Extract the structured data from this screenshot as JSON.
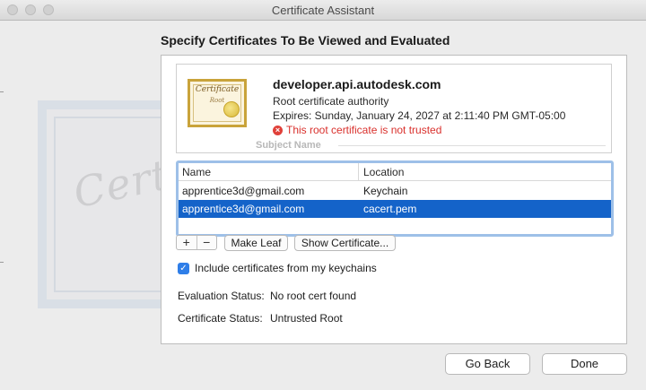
{
  "window": {
    "title": "Certificate Assistant"
  },
  "heading": "Specify Certificates To Be Viewed and Evaluated",
  "background_art": {
    "word": "Certificate"
  },
  "certificate": {
    "icon_title": "Certificate",
    "icon_sub": "Root",
    "name": "developer.api.autodesk.com",
    "kind": "Root certificate authority",
    "expires": "Expires: Sunday, January 24, 2027 at 2:11:40 PM GMT-05:00",
    "warning": "This root certificate is not trusted",
    "section_label": "Subject Name"
  },
  "table": {
    "columns": [
      "Name",
      "Location"
    ],
    "rows": [
      {
        "name": "apprentice3d@gmail.com",
        "location": "Keychain"
      },
      {
        "name": "apprentice3d@gmail.com",
        "location": "cacert.pem"
      }
    ]
  },
  "controls": {
    "add": "+",
    "remove": "−",
    "make_leaf": "Make Leaf",
    "show_certificate": "Show Certificate...",
    "include_label": "Include certificates from my keychains",
    "include_checked": true
  },
  "status": {
    "evaluation_label": "Evaluation Status:",
    "evaluation_value": "No root cert found",
    "certificate_label": "Certificate Status:",
    "certificate_value": "Untrusted Root"
  },
  "buttons": {
    "back": "Go Back",
    "done": "Done"
  },
  "colors": {
    "selection": "#1463c9",
    "warning": "#d9302c",
    "checkbox": "#2f7ee8"
  }
}
